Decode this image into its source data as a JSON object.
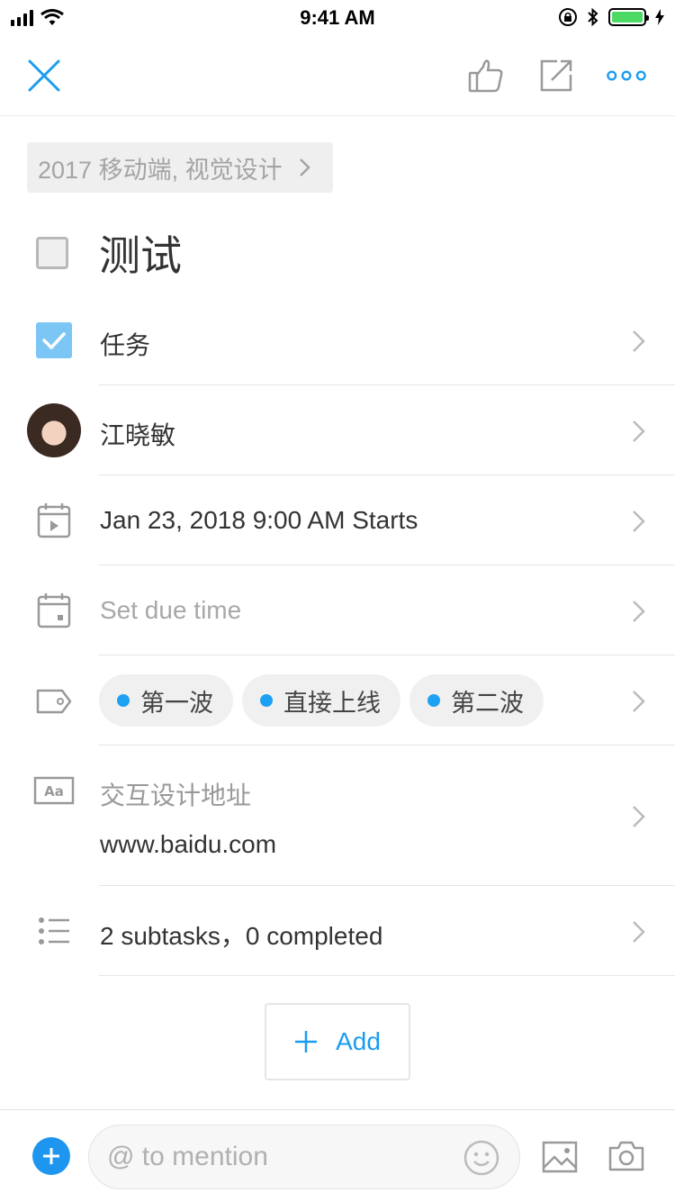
{
  "status": {
    "time": "9:41 AM"
  },
  "breadcrumb": {
    "text": "2017 移动端, 视觉设计"
  },
  "task": {
    "title": "测试"
  },
  "rows": {
    "type": {
      "label": "任务"
    },
    "assignee": {
      "label": "江晓敏"
    },
    "start": {
      "label": "Jan 23, 2018 9:00 AM Starts"
    },
    "due": {
      "placeholder": "Set due time"
    },
    "tags": [
      "第一波",
      "直接上线",
      "第二波"
    ],
    "custom_field": {
      "label": "交互设计地址",
      "value": "www.baidu.com"
    },
    "subtasks": {
      "label": "2 subtasks，0 completed"
    }
  },
  "add_button": {
    "label": "Add"
  },
  "composer": {
    "placeholder": "@ to mention"
  },
  "colors": {
    "accent": "#1a9cf0",
    "checkbox_blue": "#7cc6f6",
    "tag_dot": "#1da1f2",
    "battery": "#4cd964"
  },
  "icons": [
    "close-icon",
    "thumbs-up-icon",
    "share-icon",
    "more-icon",
    "checkbox-icon",
    "calendar-start-icon",
    "calendar-due-icon",
    "tag-icon",
    "text-field-icon",
    "list-icon",
    "chevron-right-icon",
    "plus-icon",
    "emoji-icon",
    "image-icon",
    "camera-icon"
  ]
}
